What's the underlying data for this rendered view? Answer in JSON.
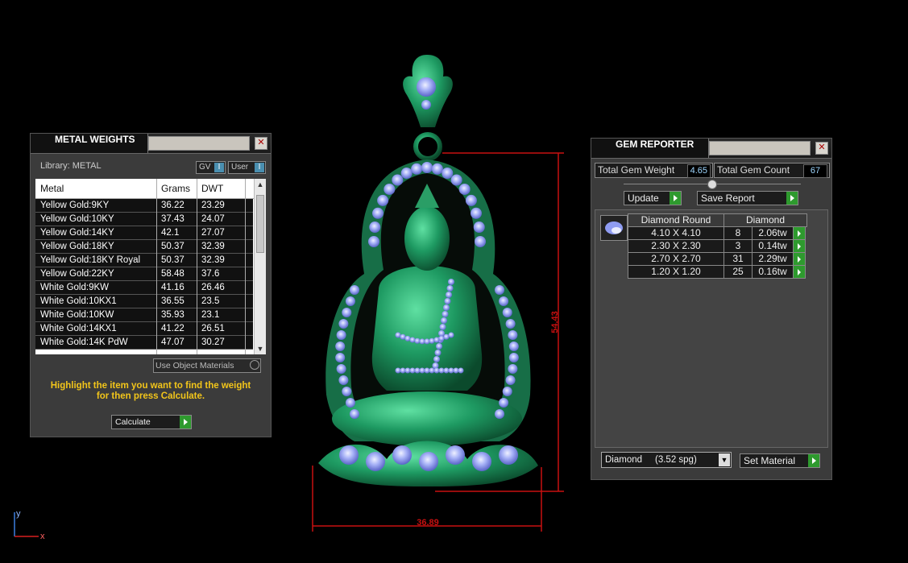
{
  "metal_panel": {
    "title": "METAL WEIGHTS",
    "library_label": "Library: METAL",
    "gv_toggle": "GV",
    "user_toggle": "User",
    "columns": [
      "Metal",
      "Grams",
      "DWT"
    ],
    "rows": [
      {
        "metal": "Yellow Gold:9KY",
        "grams": "36.22",
        "dwt": "23.29"
      },
      {
        "metal": "Yellow Gold:10KY",
        "grams": "37.43",
        "dwt": "24.07"
      },
      {
        "metal": "Yellow Gold:14KY",
        "grams": "42.1",
        "dwt": "27.07"
      },
      {
        "metal": "Yellow Gold:18KY",
        "grams": "50.37",
        "dwt": "32.39"
      },
      {
        "metal": "Yellow Gold:18KY Royal",
        "grams": "50.37",
        "dwt": "32.39"
      },
      {
        "metal": "Yellow Gold:22KY",
        "grams": "58.48",
        "dwt": "37.6"
      },
      {
        "metal": "White Gold:9KW",
        "grams": "41.16",
        "dwt": "26.46"
      },
      {
        "metal": "White Gold:10KX1",
        "grams": "36.55",
        "dwt": "23.5"
      },
      {
        "metal": "White Gold:10KW",
        "grams": "35.93",
        "dwt": "23.1"
      },
      {
        "metal": "White Gold:14KX1",
        "grams": "41.22",
        "dwt": "26.51"
      },
      {
        "metal": "White Gold:14K PdW",
        "grams": "47.07",
        "dwt": "30.27"
      }
    ],
    "use_object_materials": "Use Object Materials",
    "hint": "Highlight the item you want to find the weight for then press Calculate.",
    "calculate": "Calculate"
  },
  "gem_panel": {
    "title": "GEM REPORTER",
    "total_weight_label": "Total Gem Weight",
    "total_weight_value": "4.65",
    "total_count_label": "Total Gem Count",
    "total_count_value": "67",
    "update": "Update",
    "save_report": "Save Report",
    "header_shape": "Diamond Round",
    "header_material": "Diamond",
    "rows": [
      {
        "size": "4.10 X 4.10",
        "count": "8",
        "tw": "2.06tw"
      },
      {
        "size": "2.30 X 2.30",
        "count": "3",
        "tw": "0.14tw"
      },
      {
        "size": "2.70 X 2.70",
        "count": "31",
        "tw": "2.29tw"
      },
      {
        "size": "1.20 X 1.20",
        "count": "25",
        "tw": "0.16tw"
      }
    ],
    "material_select": "Diamond     (3.52 spg)",
    "set_material": "Set Material"
  },
  "viewport": {
    "dim_height": "54.43",
    "dim_width": "36.89",
    "axis_y": "y",
    "axis_x": "x"
  },
  "colors": {
    "pendant_green": "#1f8a5a",
    "gem_blue": "#8f9cf2",
    "dimension_red": "#c81010",
    "hint_yellow": "#f2c51a",
    "accent_green": "#2e9a2e"
  }
}
